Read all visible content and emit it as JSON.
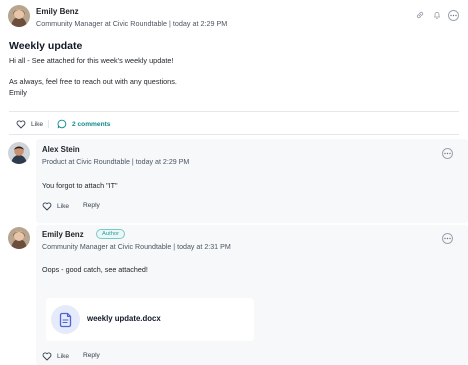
{
  "post": {
    "author": "Emily Benz",
    "meta": "Community Manager at Civic Roundtable | today at 2:29 PM",
    "title": "Weekly update",
    "body": [
      "Hi all - See attached for this week's weekly update!",
      "",
      "As always, feel free to reach out with any questions.",
      "Emily"
    ],
    "like_label": "Like",
    "comments_label": "2 comments",
    "header_icons": [
      "link-icon",
      "bell-icon",
      "more-icon"
    ]
  },
  "comments": [
    {
      "author": "Alex Stein",
      "meta": "Product at Civic Roundtable | today at 2:29 PM",
      "text": "You forgot to attach \"IT\"",
      "like_label": "Like",
      "reply_label": "Reply"
    },
    {
      "author": "Emily Benz",
      "badge": "Author",
      "meta": "Community Manager at Civic Roundtable | today at 2:31 PM",
      "text": "Oops - good catch, see attached!",
      "attachment": {
        "name": "weekly update.docx",
        "icon": "document-icon"
      },
      "like_label": "Like",
      "reply_label": "Reply"
    }
  ],
  "colors": {
    "accent": "#0f8b8d",
    "comment_bg": "#f7f8f9",
    "badge_border": "#7cc7c7",
    "icon_muted": "#9ca3af",
    "doc_icon": "#4f63d2"
  }
}
